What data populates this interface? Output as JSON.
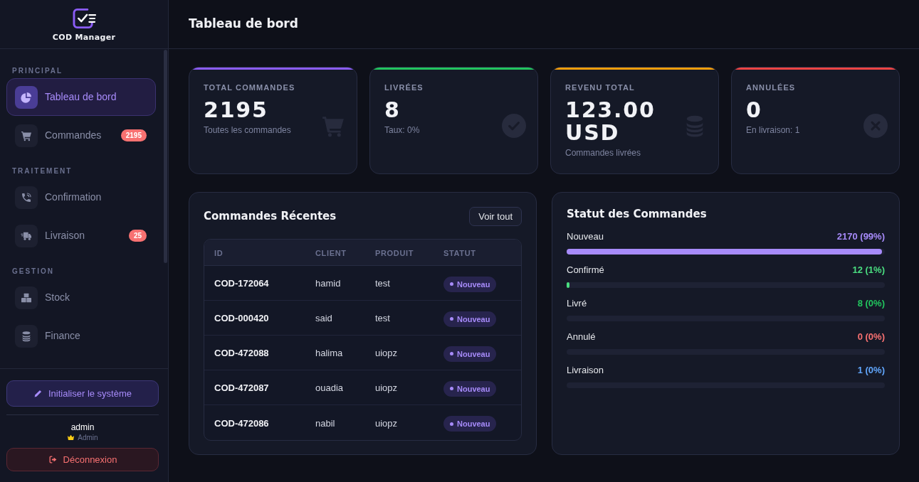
{
  "sidebar": {
    "logo": {
      "text": "COD Manager"
    },
    "sections": [
      {
        "title": "PRINCIPAL",
        "items": [
          {
            "label": "Tableau de bord",
            "selected": true
          },
          {
            "label": "Commandes",
            "selected": false,
            "badge": "2195"
          }
        ]
      },
      {
        "title": "TRAITEMENT",
        "items": [
          {
            "label": "Confirmation",
            "selected": false
          },
          {
            "label": "Livraison",
            "selected": false,
            "badge": "25"
          }
        ]
      },
      {
        "title": "GESTION",
        "items": [
          {
            "label": "Stock",
            "selected": false
          },
          {
            "label": "Finance",
            "selected": false
          }
        ]
      }
    ],
    "init_button": "Initialiser le système",
    "user": {
      "name": "admin",
      "role": "Admin"
    },
    "logout_button": "Déconnexion"
  },
  "header": {
    "title": "Tableau de bord"
  },
  "stats": [
    {
      "label": "TOTAL COMMANDES",
      "value": "2195",
      "caption": "Toutes les commandes",
      "color": "#8b5cf6"
    },
    {
      "label": "LIVRÉES",
      "value": "8",
      "caption": "Taux: 0%",
      "color": "#22c55e"
    },
    {
      "label": "REVENU TOTAL",
      "value": "123.00 USD",
      "caption": "Commandes livrées",
      "color": "#f59e0b"
    },
    {
      "label": "ANNULÉES",
      "value": "0",
      "caption": "En livraison: 1",
      "color": "#ef4444"
    }
  ],
  "recent_orders": {
    "title": "Commandes Récentes",
    "button": "Voir tout",
    "columns": [
      "ID",
      "CLIENT",
      "PRODUIT",
      "STATUT"
    ],
    "rows": [
      {
        "id": "COD-172064",
        "client": "hamid",
        "product": "test",
        "status": "Nouveau"
      },
      {
        "id": "COD-000420",
        "client": "said",
        "product": "test",
        "status": "Nouveau"
      },
      {
        "id": "COD-472088",
        "client": "halima",
        "product": "uiopz",
        "status": "Nouveau"
      },
      {
        "id": "COD-472087",
        "client": "ouadia",
        "product": "uiopz",
        "status": "Nouveau"
      },
      {
        "id": "COD-472086",
        "client": "nabil",
        "product": "uiopz",
        "status": "Nouveau"
      }
    ]
  },
  "order_status": {
    "title": "Statut des Commandes",
    "items": [
      {
        "label": "Nouveau",
        "value": "2170 (99%)",
        "level": 0.99,
        "color": "#a78bfa"
      },
      {
        "label": "Confirmé",
        "value": "12 (1%)",
        "level": 0.01,
        "color": "#4ade80"
      },
      {
        "label": "Livré",
        "value": "8 (0%)",
        "level": 0,
        "color": "#22c55e"
      },
      {
        "label": "Annulé",
        "value": "0 (0%)",
        "level": 0,
        "color": "#f87171"
      },
      {
        "label": "Livraison",
        "value": "1 (0%)",
        "level": 0,
        "color": "#60a5fa"
      }
    ]
  }
}
